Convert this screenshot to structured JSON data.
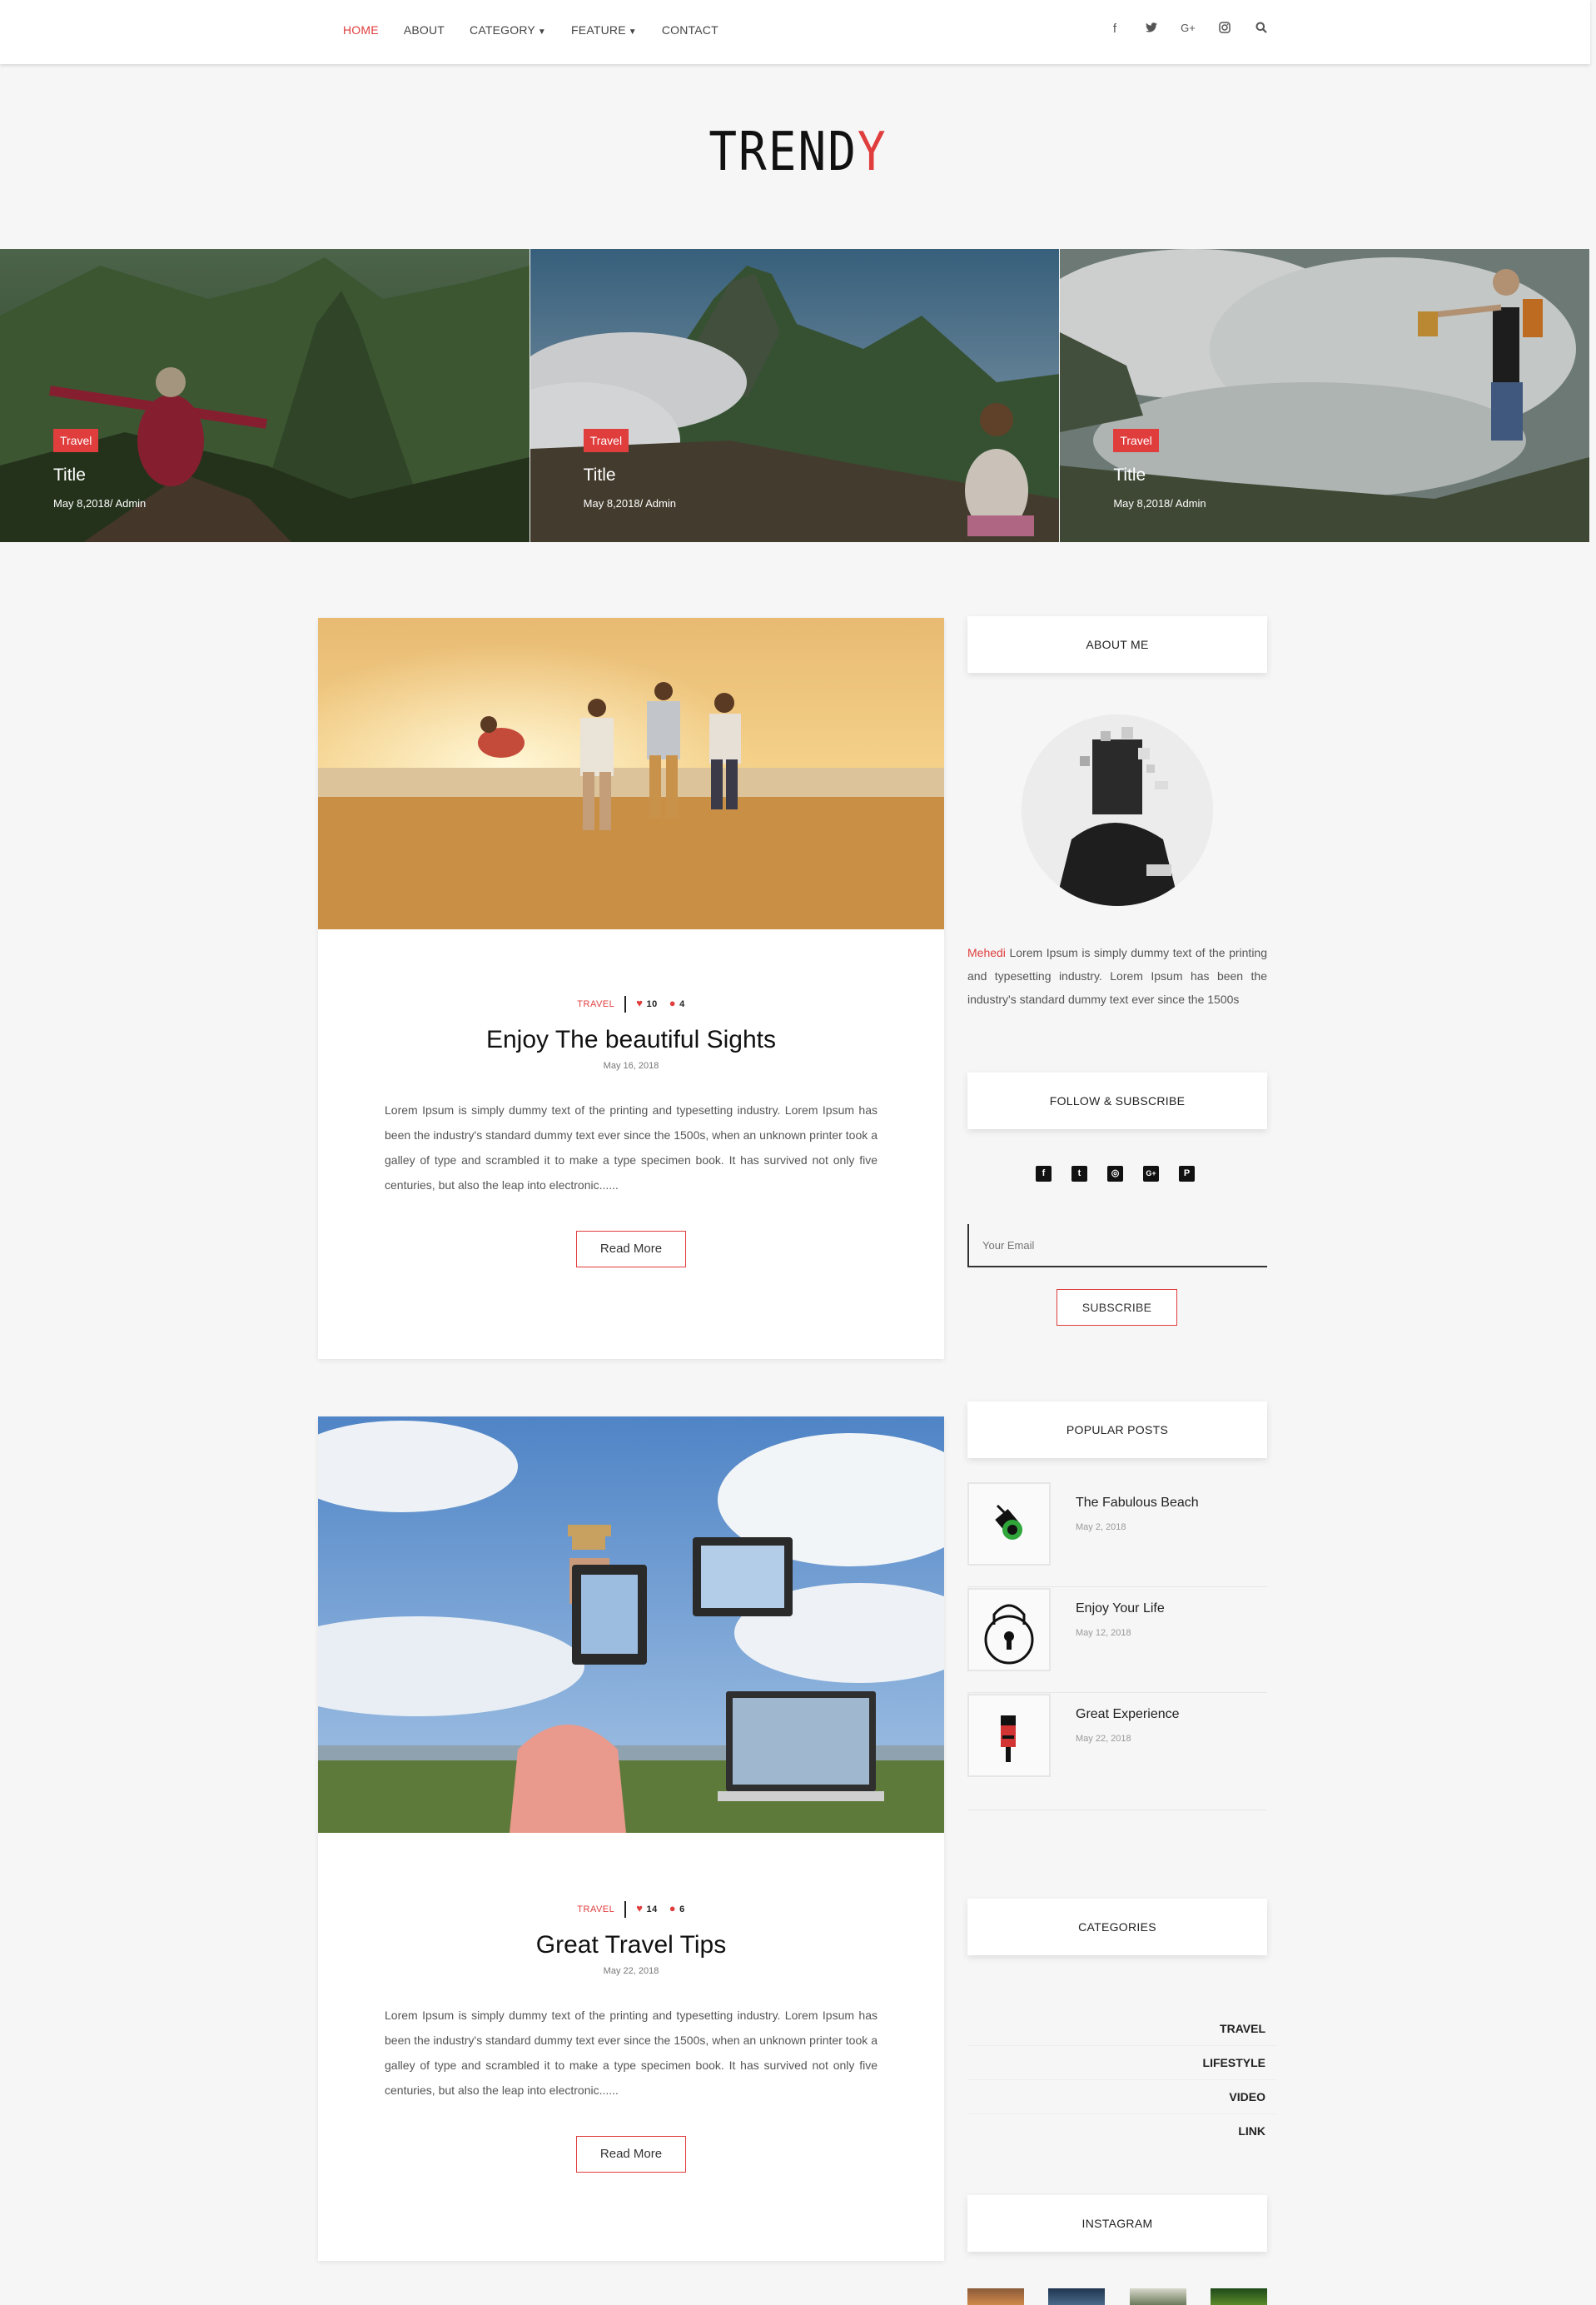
{
  "nav": {
    "items": [
      {
        "label": "HOME",
        "active": true
      },
      {
        "label": "ABOUT"
      },
      {
        "label": "CATEGORY",
        "dropdown": true
      },
      {
        "label": "FEATURE",
        "dropdown": true
      },
      {
        "label": "CONTACT"
      }
    ],
    "social": [
      {
        "icon": "facebook-icon",
        "glyph": "f"
      },
      {
        "icon": "twitter-icon",
        "glyph": "🐦"
      },
      {
        "icon": "google-plus-icon",
        "glyph": "G+"
      },
      {
        "icon": "instagram-icon",
        "glyph": "◎"
      },
      {
        "icon": "search-icon",
        "glyph": "⌕"
      }
    ]
  },
  "logo": {
    "main": "TREND",
    "accent": "Y"
  },
  "slides": [
    {
      "category": "Travel",
      "title": "Title",
      "meta": "May 8,2018/ Admin"
    },
    {
      "category": "Travel",
      "title": "Title",
      "meta": "May 8,2018/ Admin"
    },
    {
      "category": "Travel",
      "title": "Title",
      "meta": "May 8,2018/ Admin"
    }
  ],
  "posts": [
    {
      "category": "TRAVEL",
      "likes": "10",
      "comments": "4",
      "title": "Enjoy The beautiful Sights",
      "date": "May 16, 2018",
      "text": "Lorem Ipsum is simply dummy text of the printing and typesetting industry. Lorem Ipsum has been the industry's standard dummy text ever since the 1500s, when an unknown printer took a galley of type and scrambled it to make a type specimen book. It has survived not only five centuries, but also the leap into electronic......",
      "button": "Read More"
    },
    {
      "category": "TRAVEL",
      "likes": "14",
      "comments": "6",
      "title": "Great Travel Tips",
      "date": "May 22, 2018",
      "text": "Lorem Ipsum is simply dummy text of the printing and typesetting industry. Lorem Ipsum has been the industry's standard dummy text ever since the 1500s, when an unknown printer took a galley of type and scrambled it to make a type specimen book. It has survived not only five centuries, but also the leap into electronic......",
      "button": "Read More"
    }
  ],
  "sidebar": {
    "about": {
      "heading": "ABOUT ME",
      "name": "Mehedi",
      "text": " Lorem Ipsum is simply dummy text of the printing and typesetting industry. Lorem Ipsum has been the industry's standard dummy text ever since the 1500s"
    },
    "follow": {
      "heading": "FOLLOW & SUBSCRIBE",
      "icons": [
        {
          "icon": "facebook-icon",
          "glyph": "f"
        },
        {
          "icon": "twitter-icon",
          "glyph": "t"
        },
        {
          "icon": "instagram-icon",
          "glyph": "◎"
        },
        {
          "icon": "google-plus-icon",
          "glyph": "G+"
        },
        {
          "icon": "pinterest-icon",
          "glyph": "P"
        }
      ],
      "email_placeholder": "Your Email",
      "button": "SUBSCRIBE"
    },
    "popular": {
      "heading": "POPULAR POSTS",
      "items": [
        {
          "title": "The Fabulous Beach",
          "date": "May 2, 2018",
          "icon": "plug-icon"
        },
        {
          "title": "Enjoy Your Life",
          "date": "May 12, 2018",
          "icon": "lock-icon"
        },
        {
          "title": "Great Experience",
          "date": "May 22, 2018",
          "icon": "plug-icon"
        }
      ]
    },
    "categories": {
      "heading": "CATEGORIES",
      "items": [
        "TRAVEL",
        "LIFESTYLE",
        "VIDEO",
        "LINK"
      ]
    },
    "instagram": {
      "heading": "INSTAGRAM"
    }
  },
  "colors": {
    "accent": "#e03d3d"
  }
}
